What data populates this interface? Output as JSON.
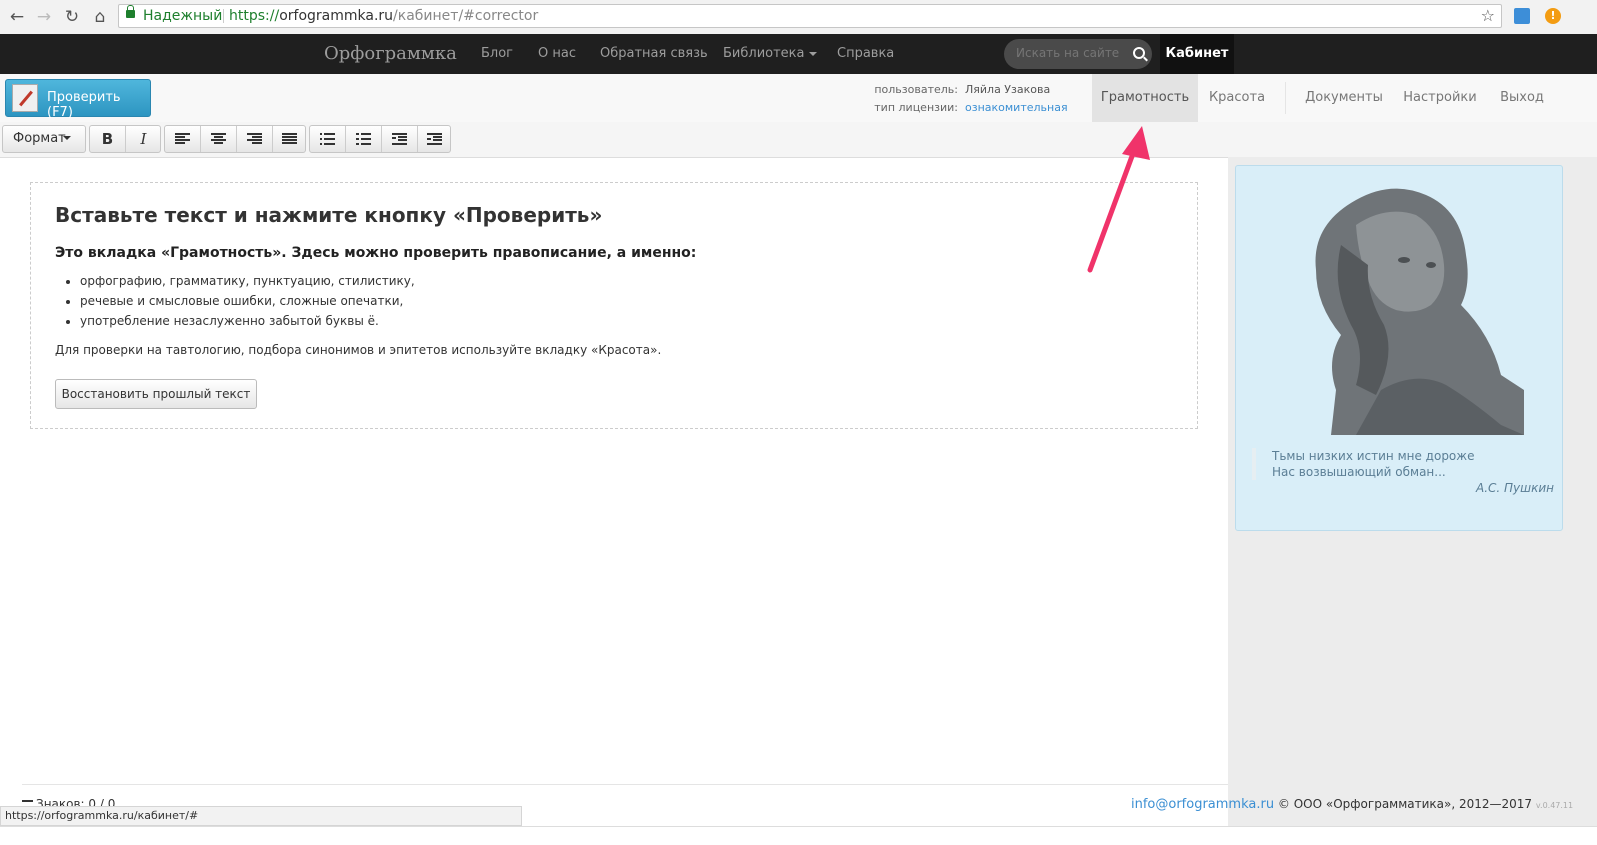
{
  "browser": {
    "secure_label": "Надежный",
    "url_scheme": "https://",
    "url_domain": "orfogrammka.ru",
    "url_path": "/кабинет/#corrector",
    "status_url": "https://orfogrammka.ru/кабинет/#"
  },
  "site": {
    "brand": "Орфограммка",
    "nav": [
      "Блог",
      "О нас",
      "Обратная связь",
      "Библиотека",
      "Справка"
    ],
    "search_placeholder": "Искать на сайте",
    "cabinet": "Кабинет"
  },
  "toolbar": {
    "check_label": "Проверить (F7)",
    "user_label": "пользователь:",
    "user_value": "Ляйла Узакова",
    "license_label": "тип лицензии:",
    "license_value": "ознакомительная",
    "tabs": [
      "Грамотность",
      "Красота",
      "Документы",
      "Настройки",
      "Выход"
    ]
  },
  "format": {
    "format_label": "Формат",
    "bold": "B",
    "italic": "I"
  },
  "content": {
    "heading": "Вставьте текст и нажмите кнопку «Проверить»",
    "subheading": "Это вкладка «Грамотность». Здесь можно проверить правописание, а именно:",
    "bullets": [
      "орфографию, грамматику, пунктуацию, стилистику,",
      "речевые и смысловые ошибки, сложные опечатки,",
      "употребление незаслуженно забытой буквы ё."
    ],
    "note": "Для проверки на тавтологию, подбора синонимов и эпитетов используйте вкладку «Красота».",
    "restore_label": "Восстановить прошлый текст"
  },
  "quote": {
    "line1": "Тьмы низких истин мне дороже",
    "line2": "Нас возвышающий обман...",
    "author": "А.С. Пушкин"
  },
  "footer": {
    "chars_label": "Знаков: 0 / 0",
    "email": "info@orfogrammka.ru",
    "copyright": "© ООО «Орфограмматика», 2012—2017",
    "version": "v.0.47.11"
  },
  "colors": {
    "nav_bg": "#1f1f1f",
    "button_blue": "#2d95c1",
    "quote_bg": "#d9eef8",
    "arrow": "#f0336a"
  }
}
